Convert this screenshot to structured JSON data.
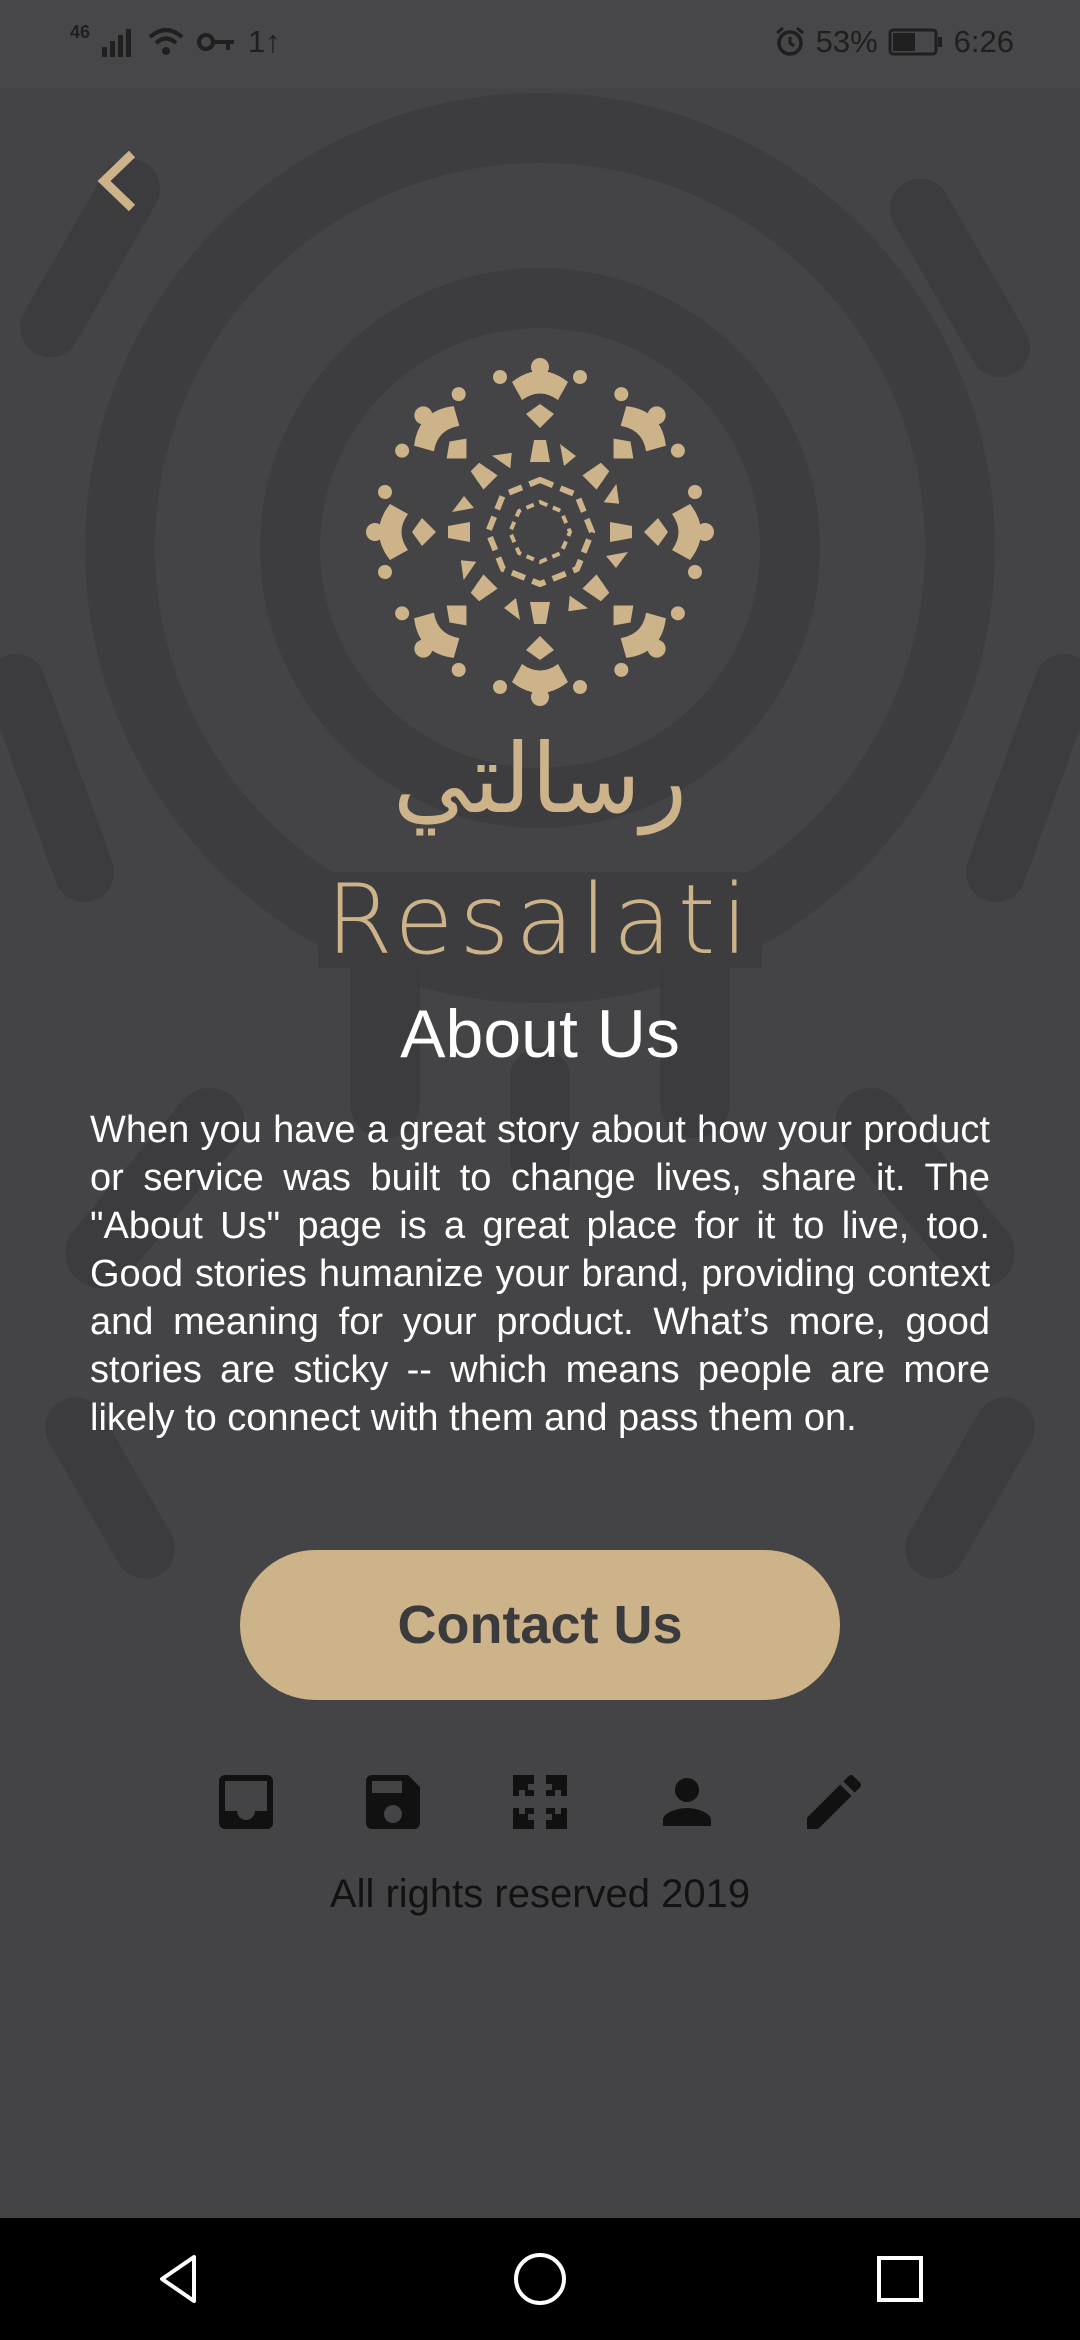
{
  "status_bar": {
    "network": "46",
    "data_indicator": "1↑",
    "alarm_icon": "alarm-icon",
    "battery_percent": "53%",
    "time": "6:26"
  },
  "header": {
    "back_icon": "chevron-left-icon"
  },
  "logo": {
    "arabic_name": "رسالتي",
    "latin_name": "Resalati"
  },
  "page": {
    "title": "About Us",
    "body": "When you have a great story about how your product or service was built to change lives, share it. The \"About Us\" page is a great place for it to live, too. Good stories humanize your brand, providing context and meaning for your product. What’s more, good stories are sticky -- which means people are more likely to connect with them and pass them on."
  },
  "actions": {
    "contact_label": "Contact Us",
    "icons": [
      "inbox-icon",
      "save-icon",
      "puzzle-icon",
      "person-icon",
      "edit-icon"
    ]
  },
  "footer": {
    "copyright": "All rights reserved 2019"
  },
  "colors": {
    "background": "#444345",
    "accent": "#cdb38a",
    "text": "#ffffff",
    "dark": "#1a1a1a"
  }
}
